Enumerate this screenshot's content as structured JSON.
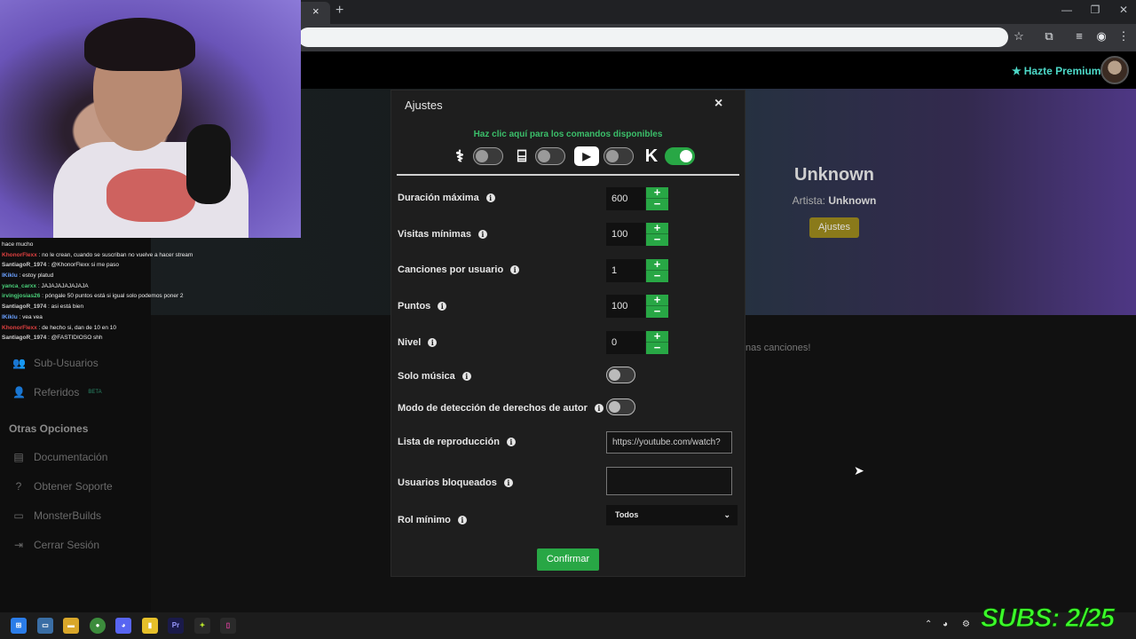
{
  "browser": {
    "tab_close": "×",
    "new_tab": "+",
    "window_buttons": [
      "—",
      "❐",
      "✕"
    ],
    "toolbar_icons": [
      "star-icon",
      "extensions-icon",
      "media-icon",
      "profile-icon",
      "menu-icon"
    ]
  },
  "header": {
    "premium_label": "Hazte Premium"
  },
  "background": {
    "song_title": "Unknown",
    "artist_label": "Artista:",
    "artist_value": "Unknown",
    "ajustes_button": "Ajustes",
    "message_fragment": "nas canciones!"
  },
  "sidebar": {
    "items": [
      {
        "label": "Sub-Usuarios",
        "icon": "users-icon"
      },
      {
        "label": "Referidos",
        "icon": "referral-icon",
        "badge": "BETA"
      }
    ],
    "section_title": "Otras Opciones",
    "other_items": [
      {
        "label": "Documentación",
        "icon": "document-icon"
      },
      {
        "label": "Obtener Soporte",
        "icon": "help-icon"
      },
      {
        "label": "MonsterBuilds",
        "icon": "monitor-icon"
      },
      {
        "label": "Cerrar Sesión",
        "icon": "logout-icon"
      }
    ]
  },
  "chat": {
    "lines": [
      {
        "user": "",
        "text": "hace mucho"
      },
      {
        "user": "KhonorFlexx",
        "text": ": no le crean, cuando se suscriban no vuelve a hacer stream",
        "color": "#e04040"
      },
      {
        "user": "SantiagoR_1974",
        "text": ": @KhonorFlexx si me paso",
        "color": "#d0d0d0"
      },
      {
        "user": "IKiklu",
        "text": ": estoy platud",
        "color": "#6aa0ff"
      },
      {
        "user": "yanca_carxx",
        "text": ": JAJAJAJAJAJAJA",
        "color": "#4ad07a"
      },
      {
        "user": "irvingjosias26",
        "text": ": póngale 50 puntos está si igual solo podemos poner 2",
        "color": "#4ad07a"
      },
      {
        "user": "SantiagoR_1974",
        "text": ": asi está bien",
        "color": "#d0d0d0"
      },
      {
        "user": "IKiklu",
        "text": ": vea vea",
        "color": "#6aa0ff"
      },
      {
        "user": "KhonorFlexx",
        "text": ": de hecho si, dan de 10 en 10",
        "color": "#e04040"
      },
      {
        "user": "SantiagoR_1974",
        "text": ": @FASTIDIOSO shh",
        "color": "#d0d0d0"
      }
    ]
  },
  "modal": {
    "title": "Ajustes",
    "close": "×",
    "commands_link": "Haz clic aquí para los comandos disponibles",
    "platforms": [
      {
        "name": "kick-style-icon",
        "glyph": "⚕",
        "enabled": false
      },
      {
        "name": "twitch-icon",
        "glyph": "⌸",
        "enabled": false
      },
      {
        "name": "youtube-icon",
        "glyph": "▶",
        "enabled": false
      },
      {
        "name": "kick-icon",
        "glyph": "K",
        "enabled": true
      }
    ],
    "numeric_fields": [
      {
        "label": "Duración máxima",
        "value": "600"
      },
      {
        "label": "Visitas mínimas",
        "value": "100"
      },
      {
        "label": "Canciones por usuario",
        "value": "1"
      },
      {
        "label": "Puntos",
        "value": "100"
      },
      {
        "label": "Nivel",
        "value": "0"
      }
    ],
    "stepper_plus": "+",
    "stepper_minus": "−",
    "toggles": [
      {
        "label": "Solo música",
        "enabled": false
      },
      {
        "label": "Modo de detección de derechos de autor",
        "enabled": false
      }
    ],
    "playlist_label": "Lista de reproducción",
    "playlist_value": "https://youtube.com/watch?",
    "blocked_label": "Usuarios bloqueados",
    "blocked_value": "",
    "role_label": "Rol mínimo",
    "role_value": "Todos",
    "info_glyph": "i",
    "confirm": "Confirmar"
  },
  "overlay": {
    "subs": "SUBS: 2/25"
  },
  "colors": {
    "accent_green": "#28a745",
    "link_green": "#3bbf6a",
    "premium_teal": "#4dd9c8",
    "subs_green": "#3cff2a"
  }
}
